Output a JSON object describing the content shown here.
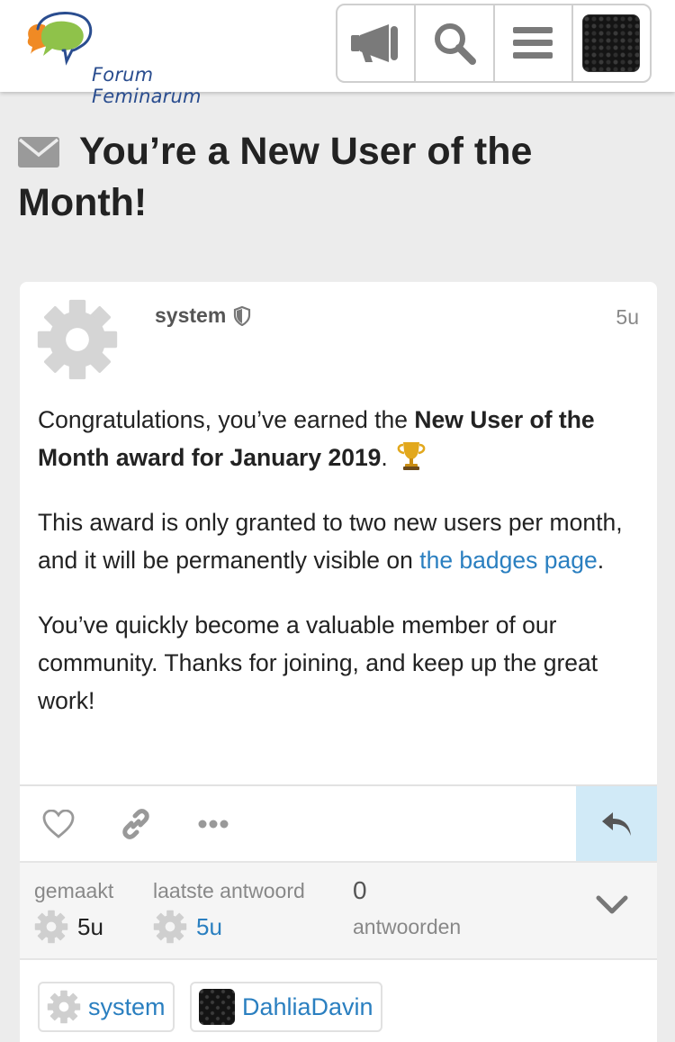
{
  "site": {
    "logo_text": "Forum Feminarum"
  },
  "header": {
    "buttons": [
      "announcement-icon",
      "search-icon",
      "menu-icon",
      "user-avatar"
    ]
  },
  "topic": {
    "title": "You’re a New User of the Month!"
  },
  "post": {
    "username": "system",
    "age": "5u",
    "p1_pre": "Congratulations, you’ve earned the ",
    "p1_bold": "New User of the Month award for January 2019",
    "p1_post": ".",
    "p2_pre": "This award is only granted to two new users per month, and it will be permanently visible on ",
    "p2_link": "the badges page",
    "p2_post": ".",
    "p3": "You’ve quickly become a valuable member of our community. Thanks for joining, and keep up the great work!"
  },
  "meta": {
    "created_label": "gemaakt",
    "created_value": "5u",
    "last_reply_label": "laatste antwoord",
    "last_reply_value": "5u",
    "replies_count": "0",
    "replies_label": "antwoorden"
  },
  "participants": [
    {
      "name": "system"
    },
    {
      "name": "DahliaDavin"
    }
  ],
  "colors": {
    "link": "#2a7fc0",
    "reply_button_bg": "#d1eaf7",
    "page_bg": "#ececec"
  }
}
